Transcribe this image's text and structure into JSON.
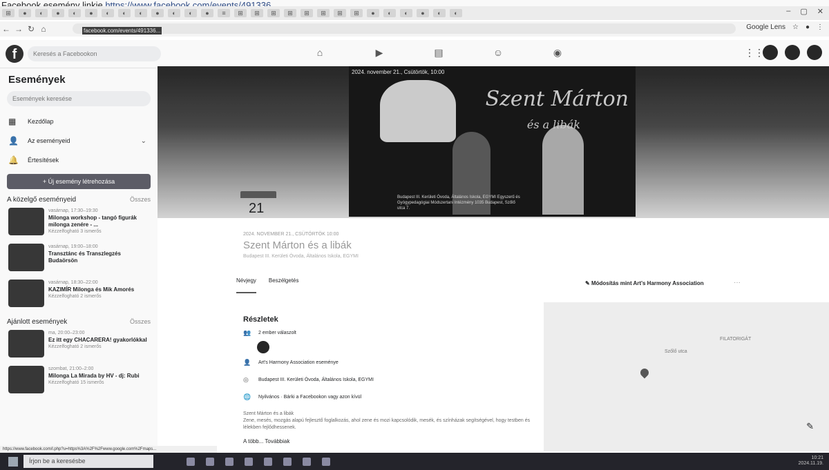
{
  "doc": {
    "prefix": "Facebook esemény linkje ",
    "link_text": "https://www.facebook.com/events/491336..."
  },
  "browser": {
    "url": "facebook.com/events/491336...",
    "tabs": [
      "⊞",
      "●",
      "◐",
      "●",
      "◐",
      "●",
      "◐",
      "◐",
      "◐",
      "●",
      "◐",
      "◐",
      "●",
      "≡",
      "⊞",
      "⊞",
      "⊞",
      "⊞",
      "⊞",
      "⊞",
      "⊞",
      "⊞",
      "●",
      "◐",
      "◐",
      "●",
      "◐",
      "◐"
    ],
    "google_lens": "Google Lens",
    "window_controls": [
      "–",
      "▢",
      "✕"
    ]
  },
  "fb": {
    "logo": "f",
    "search_placeholder": "Keresés a Facebookon",
    "nav_icons": [
      "home-icon",
      "video-icon",
      "marketplace-icon",
      "groups-icon",
      "gaming-icon"
    ]
  },
  "sidebar": {
    "title": "Események",
    "search_placeholder": "Események keresése",
    "menu": [
      {
        "icon": "▦",
        "label": "Kezdőlap"
      },
      {
        "icon": "👤",
        "label": "Az eseményeid"
      },
      {
        "icon": "🔔",
        "label": "Értesítések"
      }
    ],
    "create_button": "+ Új esemény létrehozása",
    "upcoming_title": "A közelgő eseményeid",
    "upcoming_more": "Összes",
    "upcoming": [
      {
        "date": "vasárnap, 17:30–19:30",
        "title": "Milonga workshop - tangó figurák milonga zenére - ...",
        "people": "Kézzelfogható 3 ismerős"
      },
      {
        "date": "vasárnap, 19:00–18:00",
        "title": "Transztánc és Transzlegzés Budaörsön",
        "people": ""
      },
      {
        "date": "vasárnap, 18:30–22:00",
        "title": "KAZIMÍR Milonga és Mik Amorés",
        "people": "Kézzelfogható 2 ismerős"
      }
    ],
    "suggested_title": "Ajánlott események",
    "suggested_more": "Összes",
    "suggested": [
      {
        "date": "ma, 20:00–23:00",
        "title": "Ez itt egy CHACARERA! gyakorlókkal",
        "people": "Kézzelfogható 2 ismerős"
      },
      {
        "date": "szombat, 21:00–2:00",
        "title": "Milonga La Mirada by HV - dj: Rubi",
        "people": "Kézzelfogható 15 ismerős"
      }
    ]
  },
  "cover": {
    "date_text": "2024. november 21., Csütörtök, 10:00",
    "script_title": "Szent Márton",
    "script_sub": "és a libák",
    "footer": "Budapest III. Kerületi Óvoda, Általános Iskola, EGYMI Egyszerű és Gyógypedagógiai Módszertani Intézmény 1035 Budapest, Szőlő utca 7."
  },
  "event": {
    "month": "NOV",
    "day": "21",
    "datetime": "2024. NOVEMBER 21., CSÜTÖRTÖK 10:00",
    "title": "Szent Márton és a libák",
    "location_line": "Budapest III. Kerületi Óvoda, Általános Iskola, EGYMI",
    "tabs": [
      "Névjegy",
      "Beszélgetés"
    ],
    "edit_label": "Módosítás mint Art's Harmony Association",
    "more": "···"
  },
  "details": {
    "title": "Részletek",
    "responses": "2 ember válaszolt",
    "host": "Art's Harmony Association eseménye",
    "location": "Budapest III. Kerületi Óvoda, Általános Iskola, EGYMI",
    "visibility": "Nyilvános · Bárki a Facebookon vagy azon kívül",
    "desc_head": "Szent Márton és a libák",
    "desc": "Zene, mesés, mozgás alapú fejlesztő foglalkozás, ahol zene és mozi kapcsolódik, mesék, és színházak segítségével, hogy testben és lélekben fejlődhessenek.",
    "more_link": "A több... Továbbiak"
  },
  "map": {
    "label1": "FILATORIGÁT",
    "label2": "Szőlő utca"
  },
  "statusbar": "https://www.facebook.com/l.php?u=https%3A%2F%2Fwww.google.com%2Fmaps...",
  "taskbar": {
    "search": "Írjon be a keresésbe",
    "time": "10:21",
    "date": "2024.11.19."
  }
}
